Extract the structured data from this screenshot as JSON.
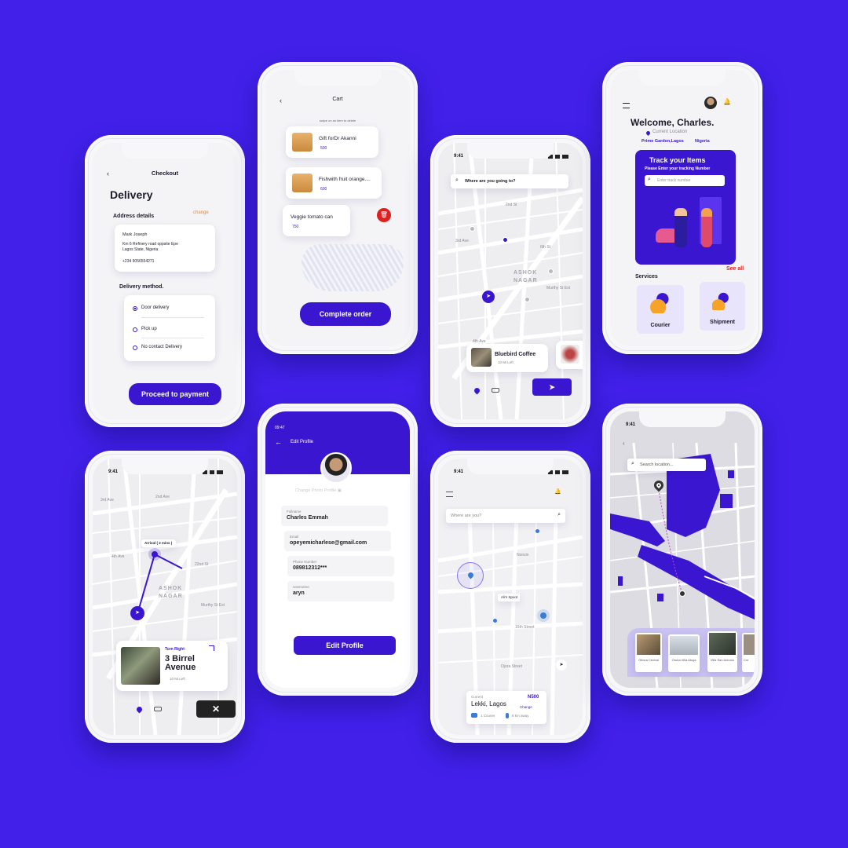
{
  "checkout": {
    "title": "Checkout",
    "heading": "Delivery",
    "address_label": "Address details",
    "change_label": "change",
    "name": "Mark Joseph",
    "address_line1": "Km 6 Refinery road oppsite Epe",
    "address_line2": "Lagos State, Nigeria",
    "phone": "+234 9056554271",
    "method_label": "Delivery method.",
    "options": [
      "Door delivery",
      "Pick up",
      "No contact Delivery"
    ],
    "proceed_label": "Proceed to payment"
  },
  "cart": {
    "title": "Cart",
    "hint": "swipe on an item to delete",
    "items": [
      {
        "name": "Gift forDr Akanni",
        "price": "500"
      },
      {
        "name": "Fishwith fruit orange....",
        "price": "600"
      },
      {
        "name": "Veggie tomato can",
        "price": "750"
      }
    ],
    "complete_label": "Complete order"
  },
  "map_search": {
    "time": "9:41",
    "search_placeholder": "Where are you going to?",
    "labels": [
      "3rd Ave",
      "4th Ave",
      "1st St",
      "2nd St",
      "ASHOK",
      "NAGAR",
      "Murthy St Ext",
      "8th Avenue",
      "7th Ave",
      "5th Ave",
      "6th St"
    ],
    "place_name": "Bluebird Coffee",
    "place_sub": "10 Mi Left"
  },
  "home": {
    "welcome": "Welcome, Charles.",
    "current_location_label": "Current Location",
    "location": "Prime Garden,Lagos",
    "country": "Nigeria",
    "track_title": "Track your Items",
    "track_sub": "Please Enter your tracking Number",
    "track_placeholder": "Enter track number",
    "services_label": "Services",
    "see_all": "See all",
    "services": [
      "Courier",
      "Shipment"
    ]
  },
  "navigation": {
    "time": "9:41",
    "labels": [
      "2nd Ave",
      "3rd Ave",
      "4th Ave",
      "1st St",
      "22nd St",
      "ASHOK",
      "NAGAR",
      "Murthy St Ext",
      "8th Avenue",
      "6th Ave"
    ],
    "arrival": "Arrival ( 2 mins )",
    "turn_label": "Turn Right",
    "street": "3 Birrel Avenue",
    "distance": "10 Mi Left"
  },
  "profile": {
    "time": "09:47",
    "title": "Edit Profile",
    "change_photo": "Change Photo Profile",
    "fields": [
      {
        "label": "Fullname",
        "value": "Charles Emmah"
      },
      {
        "label": "Email",
        "value": "opeyemicharlese@gmail.com"
      },
      {
        "label": "Phone Number",
        "value": "089812312***"
      },
      {
        "label": "Username",
        "value": "aryn"
      }
    ],
    "save_label": "Edit Profile"
  },
  "where": {
    "time": "9:41",
    "search_placeholder": "Where are you?",
    "labels": [
      "Ajose Adeogun",
      "Akin Adesola",
      "Ali's Spoot",
      "15th Street",
      "Nonsin",
      "Ojora Street"
    ],
    "current_label": "Current",
    "current_value": "Lekki, Lagos",
    "price": "N500",
    "change_label": "Change",
    "courier_label": "1 Courier",
    "time_label": "8 km away"
  },
  "search_location": {
    "time": "9:41",
    "search_placeholder": "Search location...",
    "places": [
      "Ofiona Central",
      "Oruba Villa Abuja",
      "Villa San Antonio",
      "Cre"
    ]
  },
  "colors": {
    "background": "#4220ea",
    "accent": "#3b16d1",
    "orange": "#f08a2a",
    "red": "#e02020"
  }
}
